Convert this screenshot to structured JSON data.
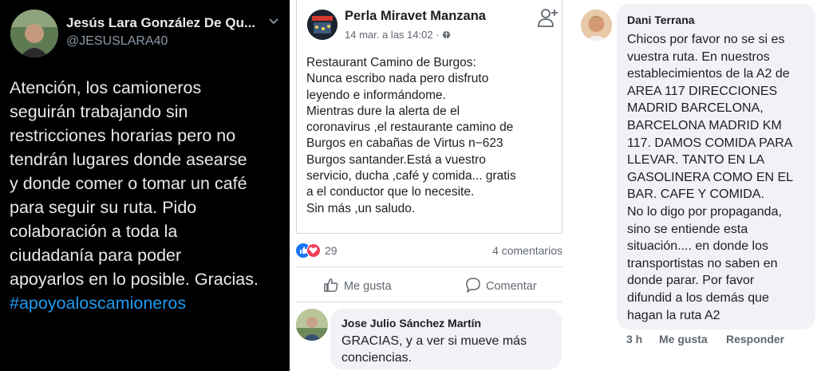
{
  "tweet": {
    "author_name": "Jesús Lara González De Qu...",
    "handle": "@JESUSLARA40",
    "body_lines": [
      "Atención, los camioneros",
      "seguirán trabajando sin",
      "restricciones horarias pero no",
      "tendrán lugares donde asearse",
      "y donde comer o tomar un café",
      "para seguir su ruta. Pido",
      "colaboración a toda la",
      "ciudadanía para poder",
      "apoyarlos en lo posible. Gracias."
    ],
    "hashtag": "#apoyoaloscamioneros",
    "icons": {
      "menu": "chevron-down-icon"
    },
    "colors": {
      "background": "#000000",
      "hashtag": "#1d9bf0"
    }
  },
  "facebook_post": {
    "author_name": "Perla Miravet Manzana",
    "timestamp": "14 mar. a las 14:02 ·",
    "icons": {
      "audience": "globe-icon",
      "add_friend": "add-friend-icon"
    },
    "text_lines": [
      "Restaurant Camino de Burgos:",
      "Nunca escribo nada pero disfruto",
      "leyendo e informándome.",
      "Mientras dure la alerta de el",
      "coronavirus ,el restaurante camino de",
      "Burgos en cabañas de Virtus  n−623",
      "Burgos santander.Está a vuestro",
      "servicio, ducha ,café y comida... gratis",
      "a el conductor que lo necesite.",
      "Sin más ,un saludo."
    ],
    "reactions_count": "29",
    "comments_count": "4 comentarios",
    "actions": {
      "like": "Me gusta",
      "comment": "Comentar"
    },
    "comment": {
      "author_name": "Jose Julio Sánchez Martín",
      "text_lines": [
        "GRACIAS, y a ver si mueve más",
        "conciencias."
      ]
    }
  },
  "facebook_comment": {
    "author_name": "Dani Terrana",
    "text_lines": [
      "Chicos por favor no se si es",
      "vuestra ruta. En nuestros",
      "establecimientos de la A2 de",
      "AREA 117 DIRECCIONES",
      "MADRID BARCELONA,",
      "BARCELONA MADRID KM",
      "117. DAMOS COMIDA PARA",
      "LLEVAR. TANTO EN LA",
      "GASOLINERA COMO EN EL",
      "BAR. CAFE Y COMIDA.",
      "No lo digo por propaganda,",
      "sino se entiende esta",
      "situación.... en donde los",
      "transportistas no saben en",
      "donde parar. Por favor",
      "difundid a los demás que",
      "hagan la ruta A2"
    ],
    "time": "3 h",
    "like_label": "Me gusta",
    "reply_label": "Responder"
  }
}
